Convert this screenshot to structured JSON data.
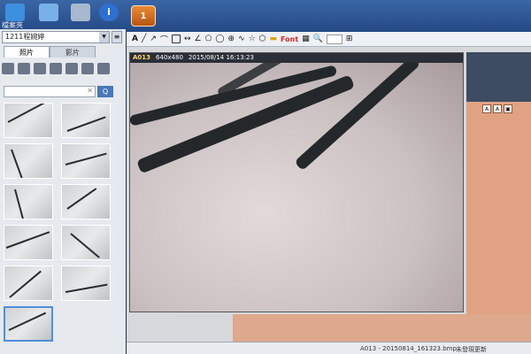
{
  "topbar": {
    "files_label": "檔案夾",
    "patient_tab_number": "1"
  },
  "sidebar": {
    "patient_select": "1211程婉婷",
    "tabs": [
      "照片",
      "影片"
    ],
    "search_placeholder": "",
    "search_button": "Q"
  },
  "toolbar": {
    "font_label": "Font",
    "prefix": "A"
  },
  "viewer": {
    "image_id": "A013",
    "resolution": "640x480",
    "timestamp": "2015/08/14 16:13:23"
  },
  "status": {
    "filename": "A013 - 20150814_161323.bmp",
    "message": "未發現更新"
  }
}
